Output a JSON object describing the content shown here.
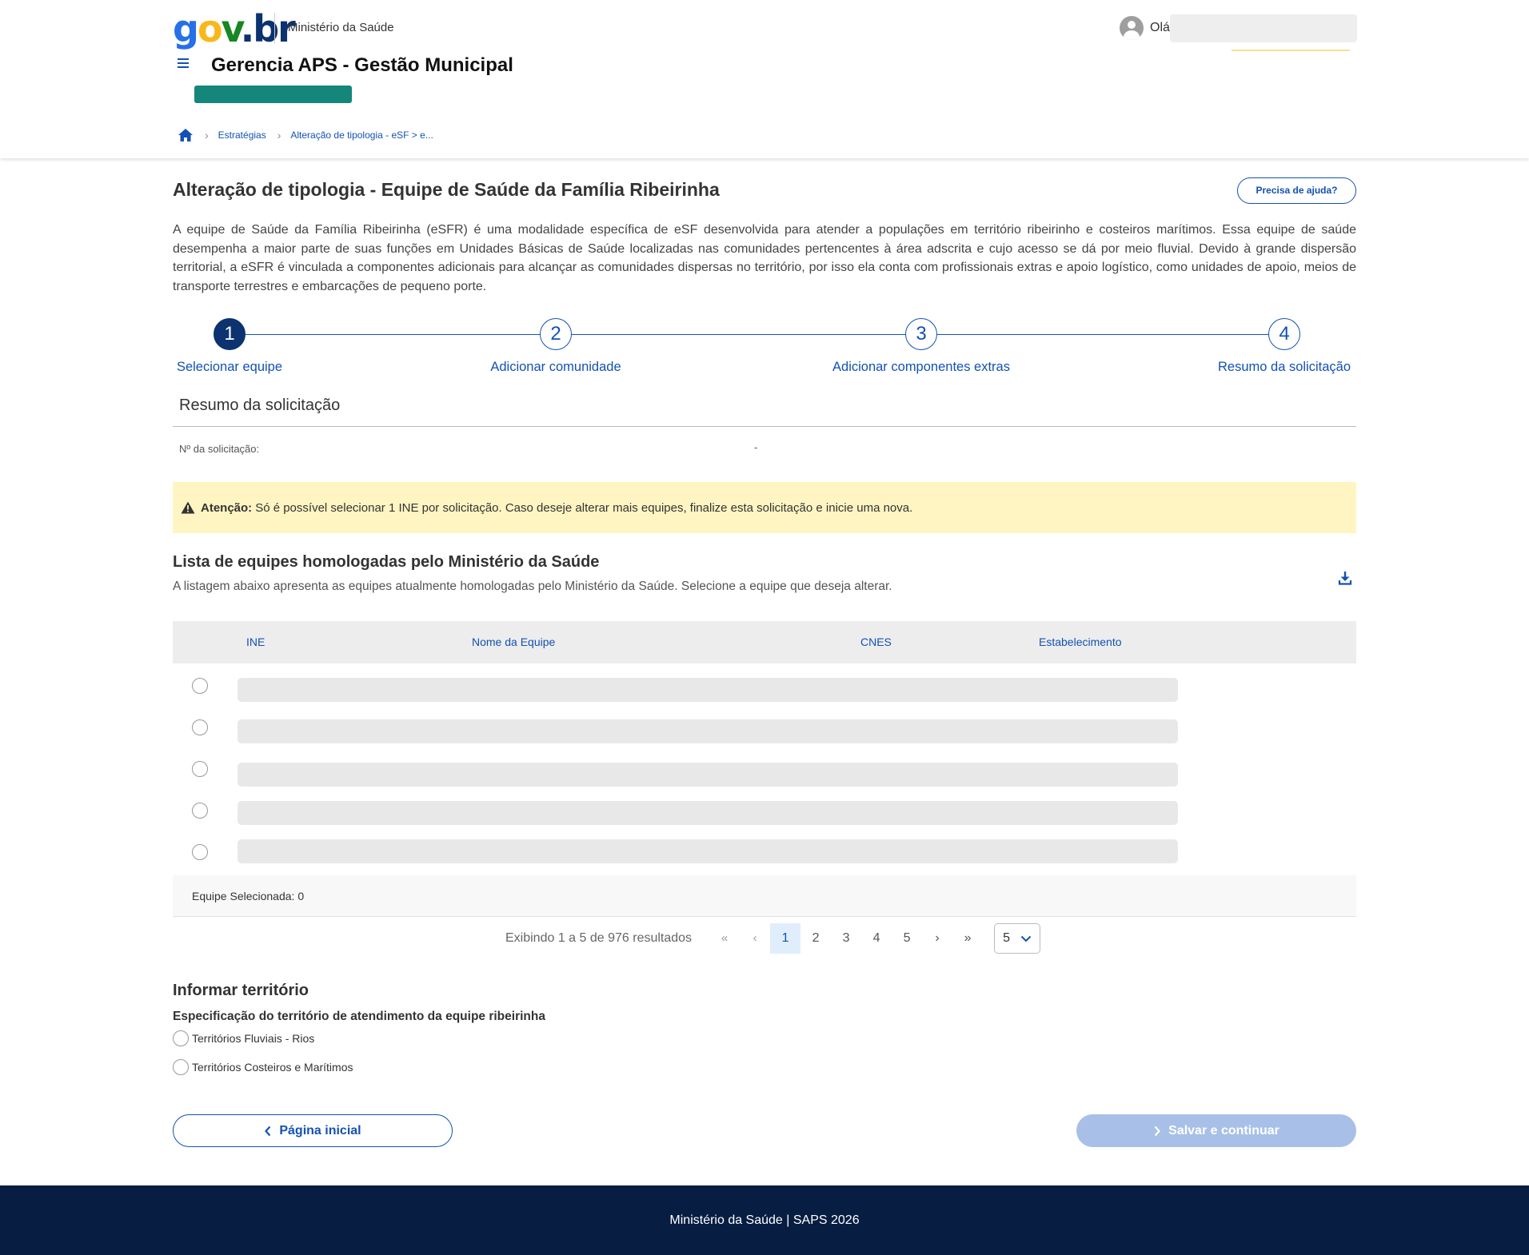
{
  "header": {
    "logo": {
      "g": "g",
      "o": "o",
      "v": "v",
      "b": ".br"
    },
    "ministry": "Ministério da Saúde",
    "user_greeting": "Olá",
    "app_title": "Gerencia APS - Gestão Municipal"
  },
  "breadcrumb": {
    "items": [
      "Estratégias",
      "Alteração de tipologia - eSF > e..."
    ]
  },
  "page": {
    "title": "Alteração de tipologia - Equipe de Saúde da Família Ribeirinha",
    "help_label": "Precisa de ajuda?",
    "description": "A equipe de Saúde da Família Ribeirinha (eSFR) é uma modalidade específica de eSF desenvolvida para atender a populações em território ribeirinho e costeiros marítimos. Essa equipe de saúde desempenha a maior parte de suas funções em Unidades Básicas de Saúde localizadas nas comunidades pertencentes à área adscrita e cujo acesso se dá por meio fluvial. Devido à grande dispersão territorial, a eSFR é vinculada a componentes adicionais para alcançar as comunidades dispersas no território, por isso ela conta com profissionais extras e apoio logístico, como unidades de apoio, meios de transporte terrestres e embarcações de pequeno porte."
  },
  "stepper": {
    "current": 1,
    "steps": [
      {
        "number": "1",
        "label": "Selecionar equipe"
      },
      {
        "number": "2",
        "label": "Adicionar comunidade"
      },
      {
        "number": "3",
        "label": "Adicionar componentes extras"
      },
      {
        "number": "4",
        "label": "Resumo da solicitação"
      }
    ]
  },
  "summary": {
    "title": "Resumo da solicitação",
    "request_number_label": "Nº da solicitação:",
    "request_number_value": "-"
  },
  "alert": {
    "strong": "Atenção:",
    "text": "Só é possível selecionar 1 INE por solicitação. Caso deseje alterar mais equipes, finalize esta solicitação e inicie uma nova."
  },
  "team_list": {
    "title": "Lista de equipes homologadas pelo Ministério da Saúde",
    "subtitle": "A listagem abaixo apresenta as equipes atualmente homologadas pelo Ministério da Saúde. Selecione a equipe que deseja alterar.",
    "columns": [
      "INE",
      "Nome da Equipe",
      "CNES",
      "Estabelecimento"
    ],
    "selected_label": "Equipe Selecionada: 0"
  },
  "pagination": {
    "info": "Exibindo 1 a 5 de 976 resultados",
    "first": "«",
    "prev": "‹",
    "pages": [
      "1",
      "2",
      "3",
      "4",
      "5"
    ],
    "current_page": "1",
    "next": "›",
    "last": "»",
    "page_size": "5"
  },
  "territory": {
    "title": "Informar território",
    "spec_label": "Especificação do território de atendimento da equipe ribeirinha",
    "options": [
      "Territórios Fluviais - Rios",
      "Territórios Costeiros e Marítimos"
    ]
  },
  "actions": {
    "back_label": "Página inicial",
    "save_label": "Salvar e continuar"
  },
  "footer": {
    "text": "Ministério da Saúde | SAPS 2026"
  },
  "colors": {
    "primary": "#1351b4",
    "dark_blue": "#0c326f",
    "footer_bg": "#071d41",
    "alert_bg": "#fff5c2",
    "badge": "#14877a",
    "disabled_button": "#a8c0e8"
  }
}
